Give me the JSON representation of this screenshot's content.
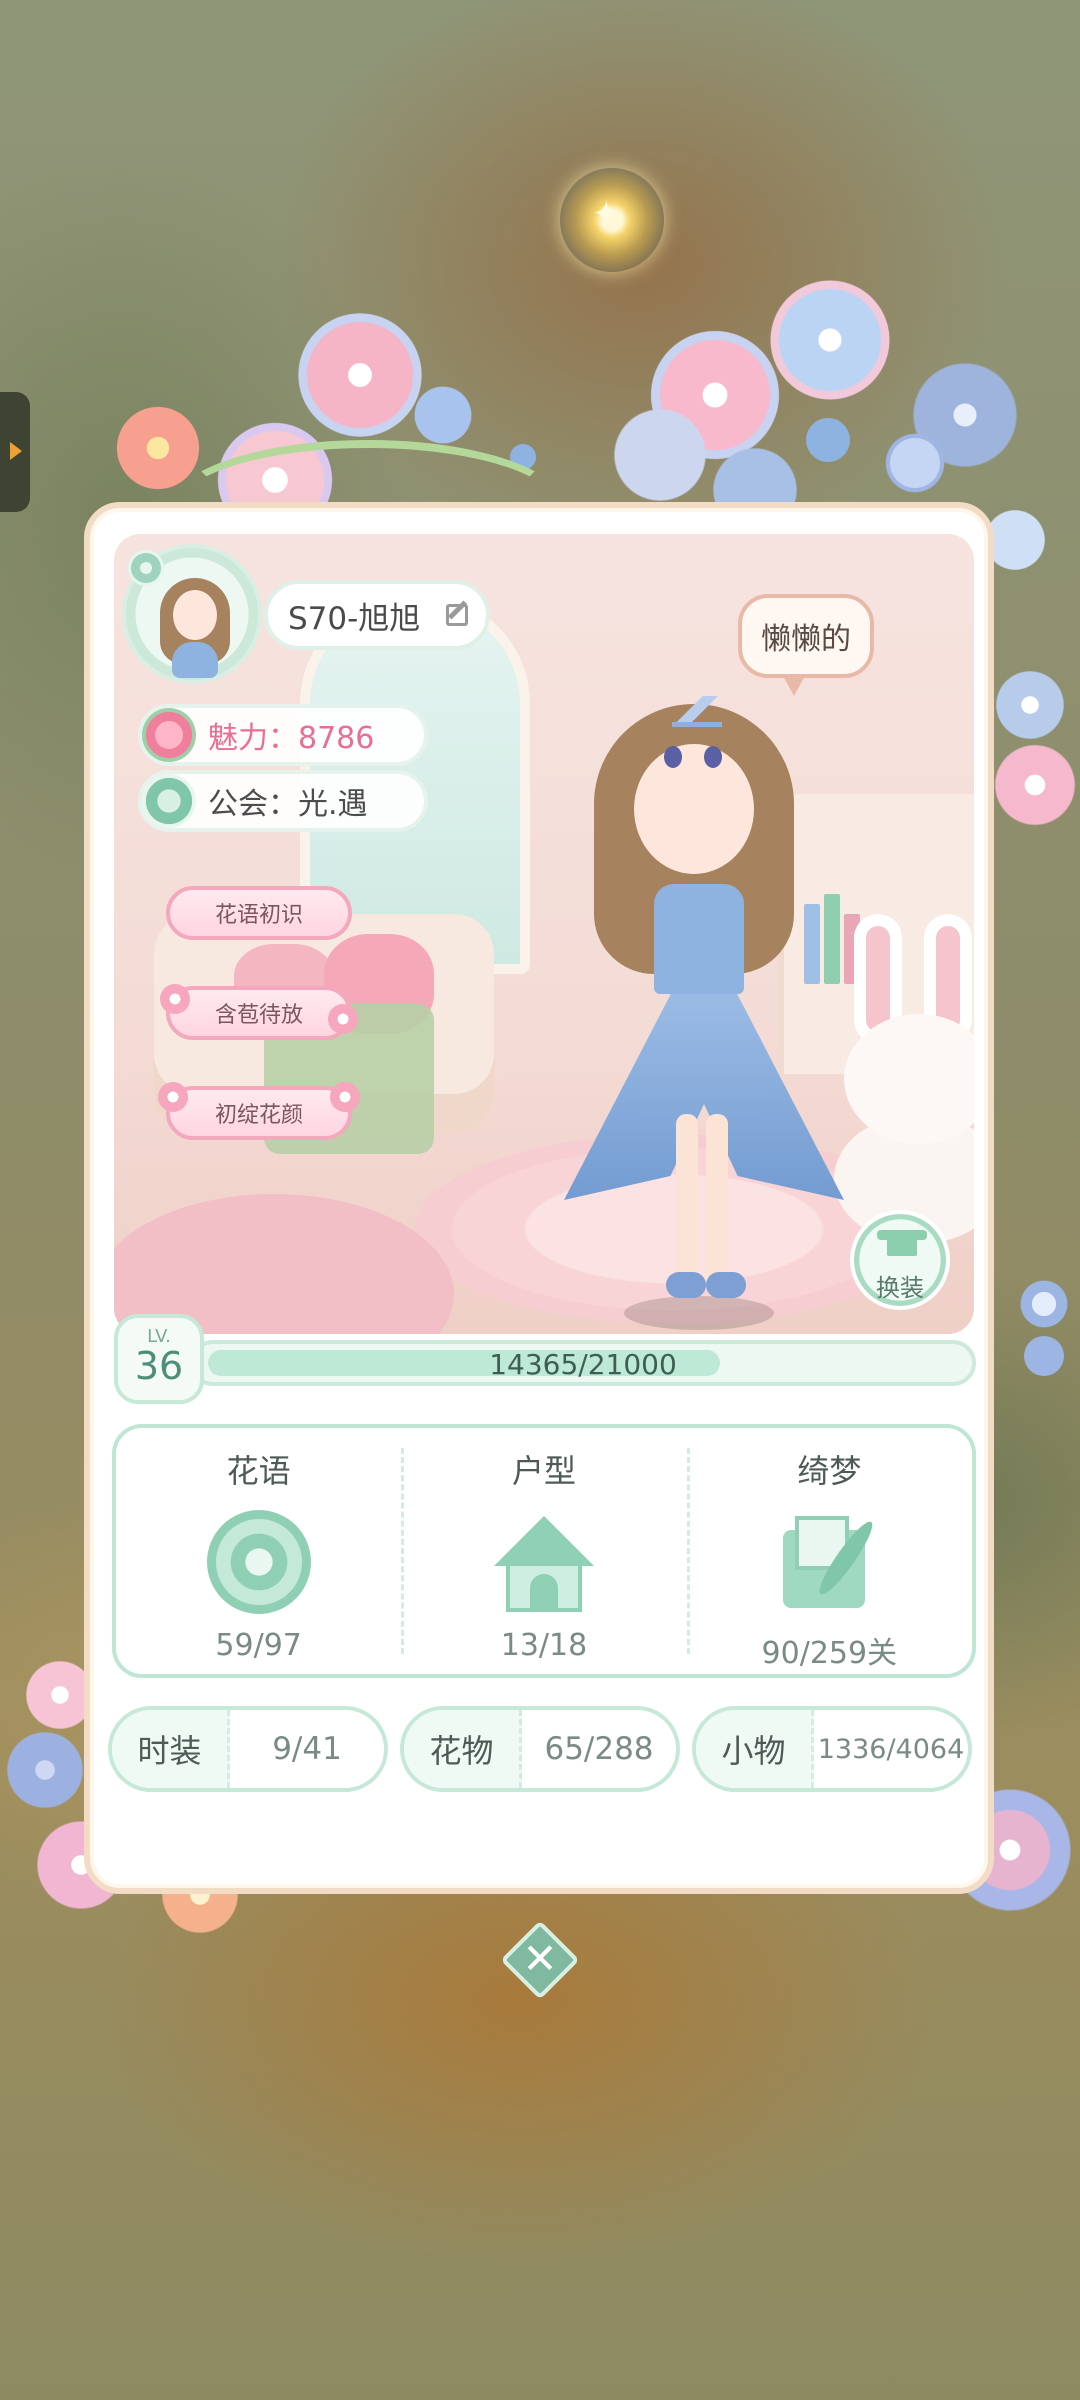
{
  "profile": {
    "name": "S70-旭旭",
    "charm_label": "魅力：8786",
    "guild_label": "公会：光.遇",
    "titles": [
      "花语初识",
      "含苞待放",
      "初绽花颜"
    ],
    "mood": "懒懒的",
    "outfit_button": "换装"
  },
  "level": {
    "label": "LV.",
    "value": "36",
    "exp_text": "14365/21000",
    "exp_fraction": 0.684
  },
  "collections": [
    {
      "title": "花语",
      "icon": "flower-icon",
      "value": "59/97"
    },
    {
      "title": "户型",
      "icon": "house-icon",
      "value": "13/18"
    },
    {
      "title": "绮梦",
      "icon": "letter-quill-icon",
      "value": "90/259关"
    }
  ],
  "stats": [
    {
      "label": "时装",
      "value": "9/41"
    },
    {
      "label": "花物",
      "value": "65/288"
    },
    {
      "label": "小物",
      "value": "1336/4064"
    }
  ],
  "colors": {
    "accent_green": "#8fd0b5",
    "charm_pink": "#e86f92",
    "card_border": "#f3dcc6"
  },
  "icons": {
    "close": "close-icon",
    "sparkle": "sparkle-icon",
    "side_arrow": "arrow-right-icon"
  }
}
